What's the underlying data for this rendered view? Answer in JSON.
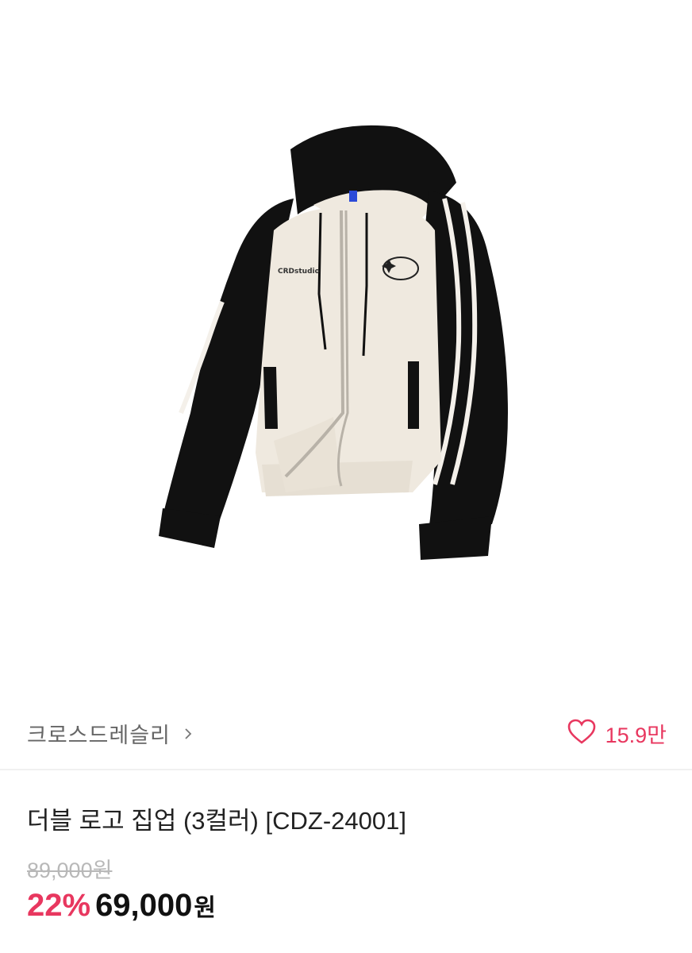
{
  "product": {
    "image_alt": "Double logo hooded zip-up jacket, cream body with black raglan sleeves and white stripes",
    "logo_text": "CRDstudio",
    "brand": "크로스드레슬리",
    "likes": "15.9만",
    "title": "더블 로고 집업 (3컬러) [CDZ-24001]",
    "original_price": "89,000원",
    "discount": "22%",
    "sale_price": "69,000",
    "currency": "원"
  },
  "colors": {
    "accent": "#e8375f",
    "jacket_body": "#efe9df",
    "jacket_sleeve": "#111111"
  },
  "icons": {
    "brand_chevron": "chevron-right-icon",
    "like": "heart-outline-icon"
  }
}
